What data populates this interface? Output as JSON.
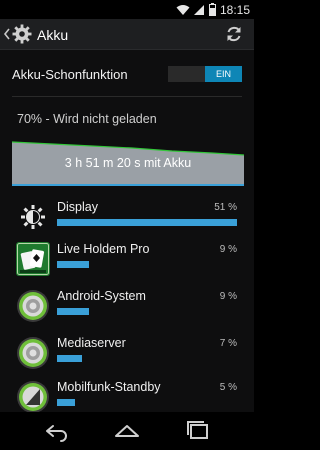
{
  "status_bar": {
    "time": "18:15",
    "icons": [
      "wifi-icon",
      "signal-icon",
      "battery-icon"
    ]
  },
  "action_bar": {
    "title": "Akku",
    "icons": [
      "up-caret-icon",
      "settings-gear-icon",
      "refresh-icon"
    ]
  },
  "battery_saver": {
    "label": "Akku-Schonfunktion",
    "toggle_state": "EIN"
  },
  "charge_status": "70% - Wird nicht geladen",
  "graph": {
    "label": "3 h 51 m 20 s mit Akku"
  },
  "apps": [
    {
      "name": "Display",
      "percent": "51 %",
      "level": 0.51,
      "icon": "brightness-icon"
    },
    {
      "name": "Live Holdem Pro",
      "percent": "9 %",
      "level": 0.09,
      "icon": "poker-app-icon"
    },
    {
      "name": "Android-System",
      "percent": "9 %",
      "level": 0.09,
      "icon": "android-system-icon"
    },
    {
      "name": "Mediaserver",
      "percent": "7 %",
      "level": 0.07,
      "icon": "android-system-icon"
    },
    {
      "name": "Mobilfunk-Standby",
      "percent": "5 %",
      "level": 0.05,
      "icon": "cell-standby-icon"
    }
  ],
  "colors": {
    "accent": "#3aa0d8",
    "toggle_on": "#0e86b6",
    "graph_line": "#33c63a",
    "graph_fill": "#9aa0a6"
  },
  "nav": [
    "back-icon",
    "home-icon",
    "recents-icon"
  ]
}
